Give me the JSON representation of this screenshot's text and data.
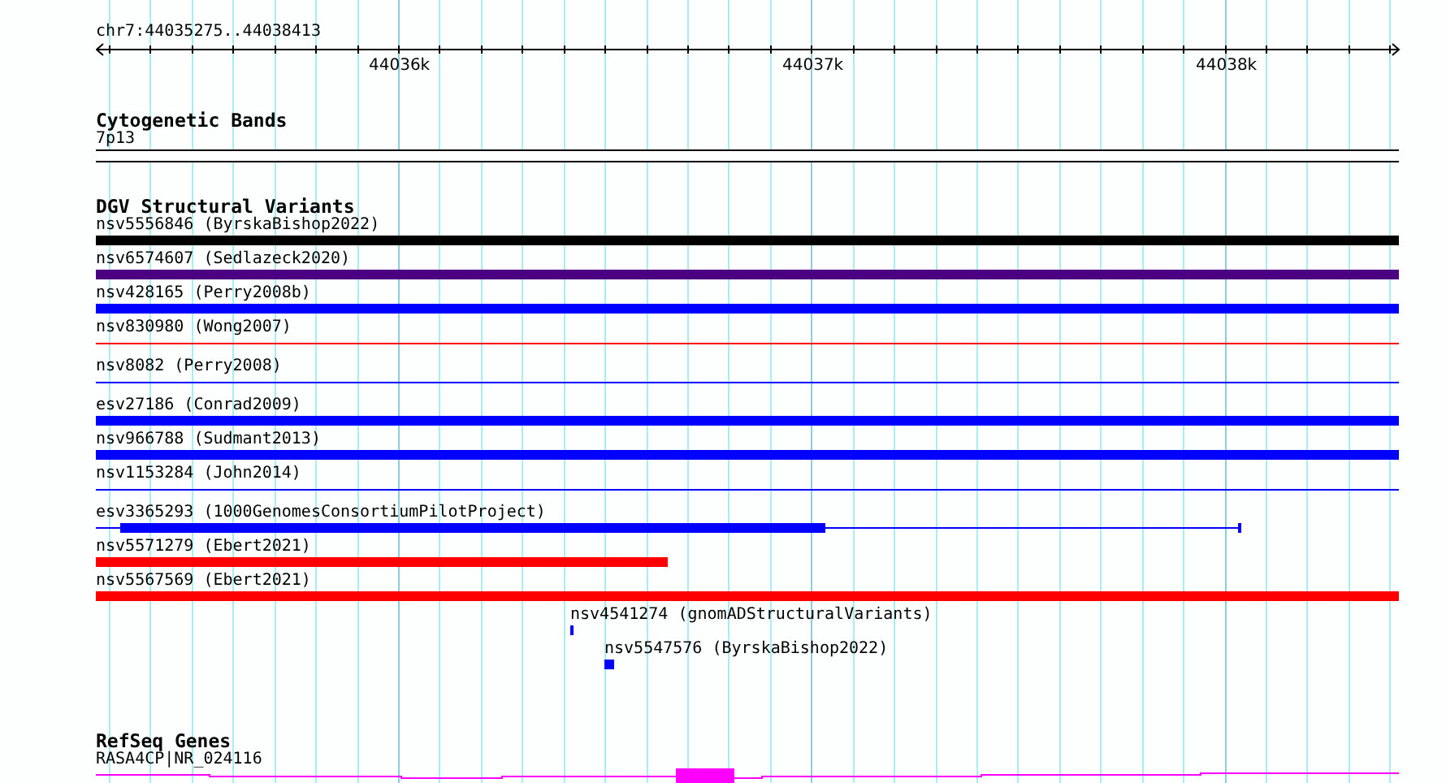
{
  "ruler": {
    "location": "chr7:44035275..44038413",
    "tick_labels": [
      "44036k",
      "44037k",
      "44038k"
    ]
  },
  "tracks": [
    {
      "title": "Cytogenetic Bands",
      "kind": "cytoband",
      "features": [
        {
          "label": "7p13"
        }
      ]
    },
    {
      "title": "DGV Structural Variants",
      "kind": "variants",
      "features": [
        {
          "label": "nsv5556846 (ByrskaBishop2022)",
          "kind": "bar",
          "color": "#000000"
        },
        {
          "label": "nsv6574607 (Sedlazeck2020)",
          "kind": "bar",
          "color": "#4b0082"
        },
        {
          "label": "nsv428165 (Perry2008b)",
          "kind": "bar",
          "color": "#0000ff"
        },
        {
          "label": "nsv830980 (Wong2007)",
          "kind": "line",
          "color": "#ff0000"
        },
        {
          "label": "nsv8082 (Perry2008)",
          "kind": "line",
          "color": "#0000ff"
        },
        {
          "label": "esv27186 (Conrad2009)",
          "kind": "bar",
          "color": "#0000ff"
        },
        {
          "label": "nsv966788 (Sudmant2013)",
          "kind": "bar",
          "color": "#0000ff"
        },
        {
          "label": "nsv1153284 (John2014)",
          "kind": "line",
          "color": "#0000ff"
        },
        {
          "label": "esv3365293 (1000GenomesConsortiumPilotProject)",
          "kind": "gapped",
          "color": "#0000ff"
        },
        {
          "label": "nsv5571279 (Ebert2021)",
          "kind": "bar",
          "color": "#ff0000"
        },
        {
          "label": "nsv5567569 (Ebert2021)",
          "kind": "bar",
          "color": "#ff0000"
        },
        {
          "label": "nsv4541274 (gnomADStructuralVariants)",
          "kind": "bar",
          "color": "#0000ff"
        },
        {
          "label": "nsv5547576 (ByrskaBishop2022)",
          "kind": "bar",
          "color": "#0000ff"
        }
      ]
    },
    {
      "title": "RefSeq Genes",
      "kind": "genes",
      "features": [
        {
          "label": "RASA4CP|NR_024116",
          "color": "#ff00ff"
        }
      ]
    }
  ]
}
